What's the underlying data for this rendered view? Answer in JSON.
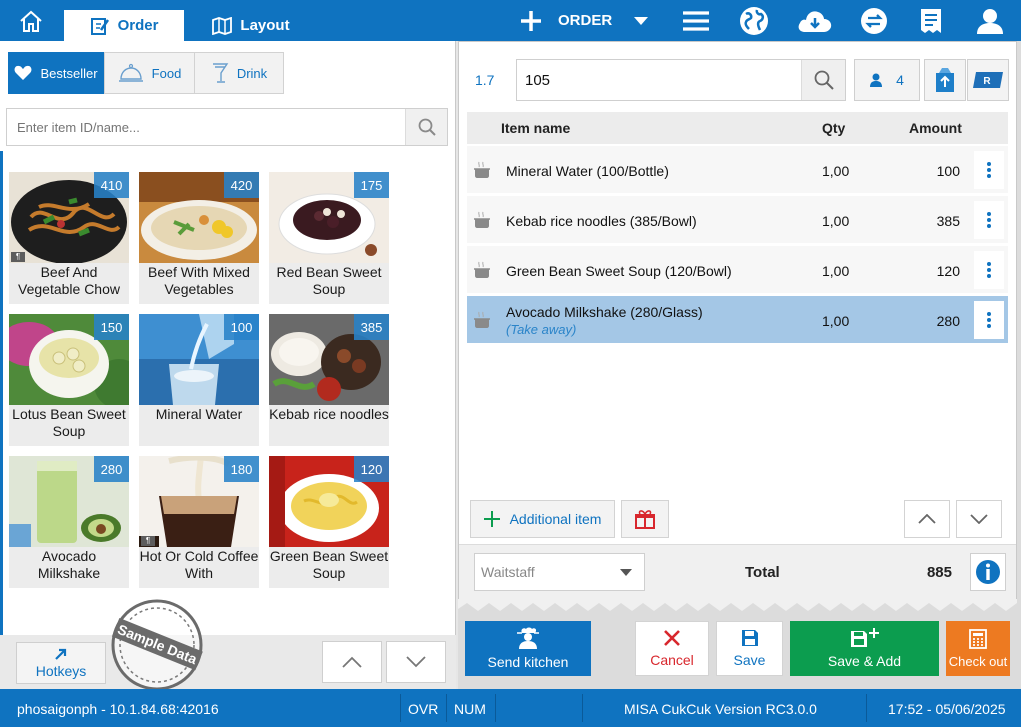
{
  "nav": {
    "order_tab": "Order",
    "layout_tab": "Layout",
    "new_order_label": "ORDER"
  },
  "categories": {
    "bestseller": "Bestseller",
    "food": "Food",
    "drink": "Drink"
  },
  "item_search": {
    "placeholder": "Enter item ID/name..."
  },
  "menu_items": [
    {
      "name": "Beef And Vegetable Chow",
      "price": "410"
    },
    {
      "name": "Beef With Mixed Vegetables",
      "price": "420"
    },
    {
      "name": "Red Bean Sweet Soup",
      "price": "175"
    },
    {
      "name": "Lotus Bean Sweet Soup",
      "price": "150"
    },
    {
      "name": "Mineral Water",
      "price": "100"
    },
    {
      "name": "Kebab rice noodles",
      "price": "385"
    },
    {
      "name": "Avocado Milkshake",
      "price": "280"
    },
    {
      "name": "Hot Or Cold Coffee With",
      "price": "180"
    },
    {
      "name": "Green Bean Sweet Soup",
      "price": "120"
    }
  ],
  "sample_stamp": "Sample Data",
  "hotkeys_label": "Hotkeys",
  "order": {
    "table_no": "1.7",
    "order_no": "105",
    "guests": "4",
    "columns": {
      "name": "Item name",
      "qty": "Qty",
      "amount": "Amount"
    },
    "rows": [
      {
        "name": "Mineral Water (100/Bottle)",
        "qty": "1,00",
        "amount": "100",
        "note": ""
      },
      {
        "name": "Kebab rice noodles (385/Bowl)",
        "qty": "1,00",
        "amount": "385",
        "note": ""
      },
      {
        "name": "Green Bean Sweet Soup (120/Bowl)",
        "qty": "1,00",
        "amount": "120",
        "note": ""
      },
      {
        "name": "Avocado Milkshake (280/Glass)",
        "qty": "1,00",
        "amount": "280",
        "note": "(Take away)"
      }
    ],
    "additional_item": "Additional item",
    "waitstaff_placeholder": "Waitstaff",
    "total_label": "Total",
    "total_value": "885"
  },
  "actions": {
    "send_kitchen": "Send kitchen",
    "cancel": "Cancel",
    "save": "Save",
    "save_add": "Save & Add",
    "checkout": "Check out"
  },
  "status": {
    "connection": "phosaigonph - 10.1.84.68:42016",
    "ovr": "OVR",
    "num": "NUM",
    "version": "MISA CukCuk Version RC3.0.0",
    "datetime": "17:52 - 05/06/2025"
  },
  "colors": {
    "primary": "#0f73c0",
    "selected_row": "#a4c7e6",
    "cancel": "#d8272d",
    "save_add": "#0c9d4f",
    "checkout": "#ed7a21"
  }
}
